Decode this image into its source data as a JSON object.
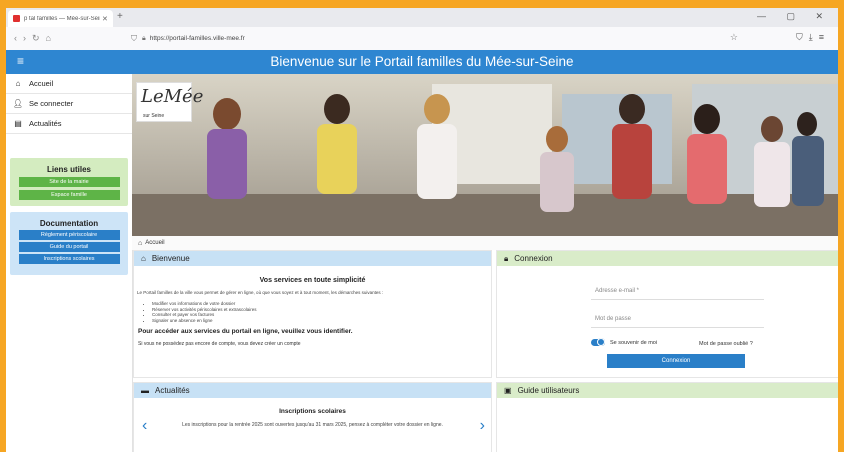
{
  "browser": {
    "tab_title": "p tal familles — Mée-sur-Seine",
    "tab_close": "✕",
    "new_tab": "+",
    "url": "https://portail-familles.ville-mee.fr",
    "window_controls": "— ▢ ✕"
  },
  "header": {
    "menu_icon": "≡",
    "title": "Bienvenue sur le Portail familles du Mée-sur-Seine"
  },
  "sidebar": {
    "items": [
      {
        "icon": "home-icon",
        "label": "Accueil"
      },
      {
        "icon": "user-icon",
        "label": "Se connecter"
      },
      {
        "icon": "news-icon",
        "label": "Actualités"
      }
    ],
    "useful_links": {
      "title": "Liens utiles",
      "buttons": [
        "Site de la mairie",
        "Espace famille"
      ]
    },
    "documentation": {
      "title": "Documentation",
      "buttons": [
        "Règlement périscolaire",
        "Guide du portail",
        "Inscriptions scolaires"
      ]
    }
  },
  "hero": {
    "logo_text": "LeMée",
    "logo_sub": "sur Seine"
  },
  "breadcrumb": {
    "label": "Accueil"
  },
  "bienvenue": {
    "title": "Bienvenue",
    "services_title": "Vos services en toute simplicité",
    "intro": "Le Portail familles de la ville vous permet de gérer en ligne, où que vous soyez et à tout moment, les démarches suivantes :",
    "bullets": [
      "Modifier vos informations de votre dossier",
      "Réserver vos activités périscolaires et extrascolaires",
      "Consulter et payer vos factures",
      "Signaler une absence en ligne"
    ],
    "access_text": "Pour accéder aux services du portail en ligne, veuillez vous identifier.",
    "no_account": "Si vous ne possédez pas encore de compte, vous devez créer un compte"
  },
  "connexion": {
    "title": "Connexion",
    "email_placeholder": "Adresse e-mail *",
    "password_placeholder": "Mot de passe",
    "remember": "Se souvenir de moi",
    "forgot": "Mot de passe oublié ?",
    "button": "Connexion"
  },
  "actualites": {
    "title": "Actualités",
    "news_title": "Inscriptions scolaires",
    "news_text": "Les inscriptions pour la rentrée 2025 sont ouvertes jusqu'au 31 mars 2025, pensez à compléter votre dossier en ligne."
  },
  "guide": {
    "title": "Guide utilisateurs"
  }
}
